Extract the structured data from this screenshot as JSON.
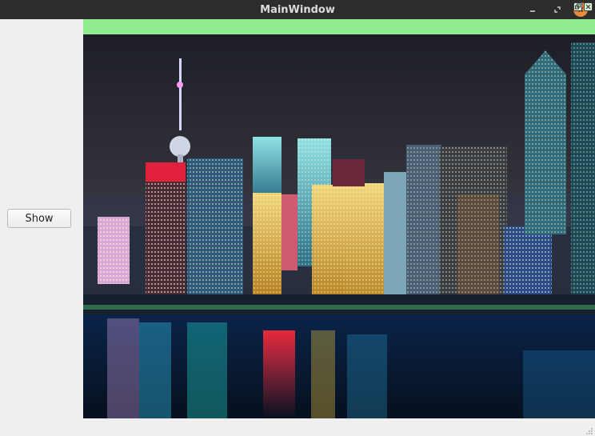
{
  "window": {
    "title": "MainWindow"
  },
  "main": {
    "show_button_label": "Show"
  },
  "dock": {
    "header_color": "#90ee90"
  },
  "icons": {
    "minimize": "minimize-icon",
    "maximize": "maximize-icon",
    "close": "close-icon",
    "dock_float": "float-icon",
    "dock_close": "close-icon"
  },
  "colors": {
    "titlebar": "#2d2d2d",
    "close_button": "#e9893a",
    "window_bg": "#efefef"
  }
}
